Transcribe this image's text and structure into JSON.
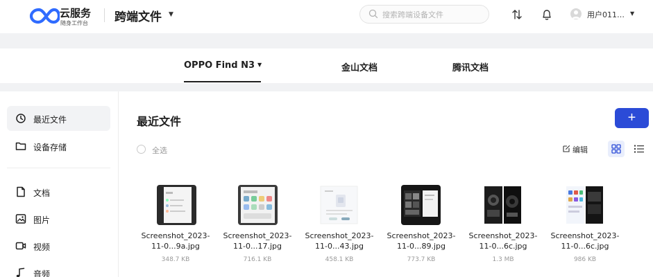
{
  "brand": {
    "name": "云服务",
    "subtitle": "随身工作台"
  },
  "header": {
    "title": "跨端文件",
    "search_placeholder": "搜索跨端设备文件",
    "user_name": "用户011…"
  },
  "tabs": [
    {
      "label": "OPPO Find N3",
      "active": true
    },
    {
      "label": "金山文档",
      "active": false
    },
    {
      "label": "腾讯文档",
      "active": false
    }
  ],
  "sidebar": {
    "items": [
      {
        "label": "最近文件",
        "icon": "clock-icon",
        "active": true
      },
      {
        "label": "设备存储",
        "icon": "folder-icon",
        "active": false
      },
      {
        "label": "文档",
        "icon": "document-icon",
        "active": false
      },
      {
        "label": "图片",
        "icon": "image-icon",
        "active": false
      },
      {
        "label": "视频",
        "icon": "video-icon",
        "active": false
      },
      {
        "label": "音频",
        "icon": "music-icon",
        "active": false
      }
    ]
  },
  "main": {
    "title": "最近文件",
    "add_label": "+",
    "select_all_label": "全选",
    "edit_label": "编辑",
    "view_mode": "grid"
  },
  "files": [
    {
      "name_line1": "Screenshot_2023-",
      "name_line2": "11-0...9a.jpg",
      "size": "348.7 KB",
      "thumb_style": "light-settings"
    },
    {
      "name_line1": "Screenshot_2023-",
      "name_line2": "11-0...17.jpg",
      "size": "716.1 KB",
      "thumb_style": "light-app-grid"
    },
    {
      "name_line1": "Screenshot_2023-",
      "name_line2": "11-0...43.jpg",
      "size": "458.1 KB",
      "thumb_style": "white-dialog"
    },
    {
      "name_line1": "Screenshot_2023-",
      "name_line2": "11-0...89.jpg",
      "size": "773.7 KB",
      "thumb_style": "dark-gallery"
    },
    {
      "name_line1": "Screenshot_2023-",
      "name_line2": "11-0...6c.jpg",
      "size": "1.3 MB",
      "thumb_style": "dark-camera"
    },
    {
      "name_line1": "Screenshot_2023-",
      "name_line2": "11-0...6c.jpg",
      "size": "986 KB",
      "thumb_style": "mixed-appstore"
    }
  ],
  "colors": {
    "accent": "#2b4bd7",
    "logo_blue": "#2f6bff",
    "page_bg": "#f1f2f4"
  }
}
